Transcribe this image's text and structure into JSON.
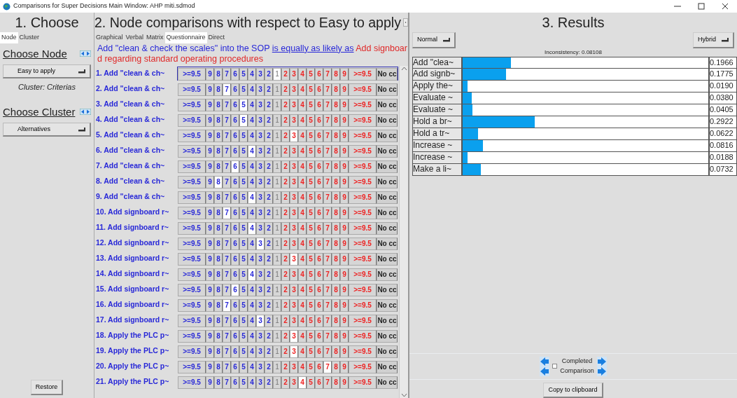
{
  "window": {
    "title": "Comparisons for Super Decisions Main Window: AHP miti.sdmod"
  },
  "choose": {
    "heading": "1. Choose",
    "tabs": [
      {
        "label": "Node",
        "selected": true
      },
      {
        "label": "Cluster",
        "selected": false
      }
    ],
    "node_label": "Choose Node",
    "node_dropdown": "Easy to apply",
    "cluster_info": "Cluster: Criterias",
    "cluster_label": "Choose Cluster",
    "cluster_dropdown": "Alternatives",
    "restore_button": "Restore"
  },
  "comparisons": {
    "heading": "2. Node comparisons with respect to Easy to apply",
    "tabs": [
      {
        "label": "Graphical",
        "selected": false
      },
      {
        "label": "Verbal",
        "selected": false
      },
      {
        "label": "Matrix",
        "selected": false
      },
      {
        "label": "Questionnaire",
        "selected": true
      },
      {
        "label": "Direct",
        "selected": false
      }
    ],
    "statement": {
      "left": "Add \"clean & check the scales\" into the SOP",
      "relation": "is equally as likely as",
      "right": "Add signboard regarding standard operating procedures"
    },
    "rows": [
      {
        "label": "1. Add \"clean & ch~",
        "current": true,
        "left": [
          {
            "text": ">=9.5",
            "selected": false
          },
          {
            "text": "9",
            "selected": false
          },
          {
            "text": "8",
            "selected": false
          },
          {
            "text": "7",
            "selected": false
          },
          {
            "text": "6",
            "selected": false
          },
          {
            "text": "5",
            "selected": false
          },
          {
            "text": "4",
            "selected": false
          },
          {
            "text": "3",
            "selected": false
          },
          {
            "text": "2",
            "selected": false
          }
        ],
        "equal": {
          "text": "1",
          "selected": true
        },
        "right": [
          {
            "text": "2",
            "selected": false
          },
          {
            "text": "3",
            "selected": false
          },
          {
            "text": "4",
            "selected": false
          },
          {
            "text": "5",
            "selected": false
          },
          {
            "text": "6",
            "selected": false
          },
          {
            "text": "7",
            "selected": false
          },
          {
            "text": "8",
            "selected": false
          },
          {
            "text": "9",
            "selected": false
          },
          {
            "text": ">=9.5",
            "selected": false
          }
        ],
        "no_comparison": "No cc"
      },
      {
        "label": "2. Add \"clean & ch~",
        "current": false,
        "left": [
          {
            "text": ">=9.5",
            "selected": false
          },
          {
            "text": "9",
            "selected": false
          },
          {
            "text": "8",
            "selected": false
          },
          {
            "text": "7",
            "selected": true
          },
          {
            "text": "6",
            "selected": false
          },
          {
            "text": "5",
            "selected": false
          },
          {
            "text": "4",
            "selected": false
          },
          {
            "text": "3",
            "selected": false
          },
          {
            "text": "2",
            "selected": false
          }
        ],
        "equal": {
          "text": "1",
          "selected": false
        },
        "right": [
          {
            "text": "2",
            "selected": false
          },
          {
            "text": "3",
            "selected": false
          },
          {
            "text": "4",
            "selected": false
          },
          {
            "text": "5",
            "selected": false
          },
          {
            "text": "6",
            "selected": false
          },
          {
            "text": "7",
            "selected": false
          },
          {
            "text": "8",
            "selected": false
          },
          {
            "text": "9",
            "selected": false
          },
          {
            "text": ">=9.5",
            "selected": false
          }
        ],
        "no_comparison": "No cc"
      },
      {
        "label": "3. Add \"clean & ch~",
        "current": false,
        "left": [
          {
            "text": ">=9.5",
            "selected": false
          },
          {
            "text": "9",
            "selected": false
          },
          {
            "text": "8",
            "selected": false
          },
          {
            "text": "7",
            "selected": false
          },
          {
            "text": "6",
            "selected": false
          },
          {
            "text": "5",
            "selected": true
          },
          {
            "text": "4",
            "selected": false
          },
          {
            "text": "3",
            "selected": false
          },
          {
            "text": "2",
            "selected": false
          }
        ],
        "equal": {
          "text": "1",
          "selected": false
        },
        "right": [
          {
            "text": "2",
            "selected": false
          },
          {
            "text": "3",
            "selected": false
          },
          {
            "text": "4",
            "selected": false
          },
          {
            "text": "5",
            "selected": false
          },
          {
            "text": "6",
            "selected": false
          },
          {
            "text": "7",
            "selected": false
          },
          {
            "text": "8",
            "selected": false
          },
          {
            "text": "9",
            "selected": false
          },
          {
            "text": ">=9.5",
            "selected": false
          }
        ],
        "no_comparison": "No cc"
      },
      {
        "label": "4. Add \"clean & ch~",
        "current": false,
        "left": [
          {
            "text": ">=9.5",
            "selected": false
          },
          {
            "text": "9",
            "selected": false
          },
          {
            "text": "8",
            "selected": false
          },
          {
            "text": "7",
            "selected": false
          },
          {
            "text": "6",
            "selected": false
          },
          {
            "text": "5",
            "selected": true
          },
          {
            "text": "4",
            "selected": false
          },
          {
            "text": "3",
            "selected": false
          },
          {
            "text": "2",
            "selected": false
          }
        ],
        "equal": {
          "text": "1",
          "selected": false
        },
        "right": [
          {
            "text": "2",
            "selected": false
          },
          {
            "text": "3",
            "selected": false
          },
          {
            "text": "4",
            "selected": false
          },
          {
            "text": "5",
            "selected": false
          },
          {
            "text": "6",
            "selected": false
          },
          {
            "text": "7",
            "selected": false
          },
          {
            "text": "8",
            "selected": false
          },
          {
            "text": "9",
            "selected": false
          },
          {
            "text": ">=9.5",
            "selected": false
          }
        ],
        "no_comparison": "No cc"
      },
      {
        "label": "5. Add \"clean & ch~",
        "current": false,
        "left": [
          {
            "text": ">=9.5",
            "selected": false
          },
          {
            "text": "9",
            "selected": false
          },
          {
            "text": "8",
            "selected": false
          },
          {
            "text": "7",
            "selected": false
          },
          {
            "text": "6",
            "selected": false
          },
          {
            "text": "5",
            "selected": false
          },
          {
            "text": "4",
            "selected": false
          },
          {
            "text": "3",
            "selected": false
          },
          {
            "text": "2",
            "selected": false
          }
        ],
        "equal": {
          "text": "1",
          "selected": false
        },
        "right": [
          {
            "text": "2",
            "selected": false
          },
          {
            "text": "3",
            "selected": true
          },
          {
            "text": "4",
            "selected": false
          },
          {
            "text": "5",
            "selected": false
          },
          {
            "text": "6",
            "selected": false
          },
          {
            "text": "7",
            "selected": false
          },
          {
            "text": "8",
            "selected": false
          },
          {
            "text": "9",
            "selected": false
          },
          {
            "text": ">=9.5",
            "selected": false
          }
        ],
        "no_comparison": "No cc"
      },
      {
        "label": "6. Add \"clean & ch~",
        "current": false,
        "left": [
          {
            "text": ">=9.5",
            "selected": false
          },
          {
            "text": "9",
            "selected": false
          },
          {
            "text": "8",
            "selected": false
          },
          {
            "text": "7",
            "selected": false
          },
          {
            "text": "6",
            "selected": false
          },
          {
            "text": "5",
            "selected": false
          },
          {
            "text": "4",
            "selected": true
          },
          {
            "text": "3",
            "selected": false
          },
          {
            "text": "2",
            "selected": false
          }
        ],
        "equal": {
          "text": "1",
          "selected": false
        },
        "right": [
          {
            "text": "2",
            "selected": false
          },
          {
            "text": "3",
            "selected": false
          },
          {
            "text": "4",
            "selected": false
          },
          {
            "text": "5",
            "selected": false
          },
          {
            "text": "6",
            "selected": false
          },
          {
            "text": "7",
            "selected": false
          },
          {
            "text": "8",
            "selected": false
          },
          {
            "text": "9",
            "selected": false
          },
          {
            "text": ">=9.5",
            "selected": false
          }
        ],
        "no_comparison": "No cc"
      },
      {
        "label": "7. Add \"clean & ch~",
        "current": false,
        "left": [
          {
            "text": ">=9.5",
            "selected": false
          },
          {
            "text": "9",
            "selected": false
          },
          {
            "text": "8",
            "selected": false
          },
          {
            "text": "7",
            "selected": false
          },
          {
            "text": "6",
            "selected": true
          },
          {
            "text": "5",
            "selected": false
          },
          {
            "text": "4",
            "selected": false
          },
          {
            "text": "3",
            "selected": false
          },
          {
            "text": "2",
            "selected": false
          }
        ],
        "equal": {
          "text": "1",
          "selected": false
        },
        "right": [
          {
            "text": "2",
            "selected": false
          },
          {
            "text": "3",
            "selected": false
          },
          {
            "text": "4",
            "selected": false
          },
          {
            "text": "5",
            "selected": false
          },
          {
            "text": "6",
            "selected": false
          },
          {
            "text": "7",
            "selected": false
          },
          {
            "text": "8",
            "selected": false
          },
          {
            "text": "9",
            "selected": false
          },
          {
            "text": ">=9.5",
            "selected": false
          }
        ],
        "no_comparison": "No cc"
      },
      {
        "label": "8. Add \"clean & ch~",
        "current": false,
        "left": [
          {
            "text": ">=9.5",
            "selected": false
          },
          {
            "text": "9",
            "selected": false
          },
          {
            "text": "8",
            "selected": true
          },
          {
            "text": "7",
            "selected": false
          },
          {
            "text": "6",
            "selected": false
          },
          {
            "text": "5",
            "selected": false
          },
          {
            "text": "4",
            "selected": false
          },
          {
            "text": "3",
            "selected": false
          },
          {
            "text": "2",
            "selected": false
          }
        ],
        "equal": {
          "text": "1",
          "selected": false
        },
        "right": [
          {
            "text": "2",
            "selected": false
          },
          {
            "text": "3",
            "selected": false
          },
          {
            "text": "4",
            "selected": false
          },
          {
            "text": "5",
            "selected": false
          },
          {
            "text": "6",
            "selected": false
          },
          {
            "text": "7",
            "selected": false
          },
          {
            "text": "8",
            "selected": false
          },
          {
            "text": "9",
            "selected": false
          },
          {
            "text": ">=9.5",
            "selected": false
          }
        ],
        "no_comparison": "No cc"
      },
      {
        "label": "9. Add \"clean & ch~",
        "current": false,
        "left": [
          {
            "text": ">=9.5",
            "selected": false
          },
          {
            "text": "9",
            "selected": false
          },
          {
            "text": "8",
            "selected": false
          },
          {
            "text": "7",
            "selected": false
          },
          {
            "text": "6",
            "selected": false
          },
          {
            "text": "5",
            "selected": false
          },
          {
            "text": "4",
            "selected": true
          },
          {
            "text": "3",
            "selected": false
          },
          {
            "text": "2",
            "selected": false
          }
        ],
        "equal": {
          "text": "1",
          "selected": false
        },
        "right": [
          {
            "text": "2",
            "selected": false
          },
          {
            "text": "3",
            "selected": false
          },
          {
            "text": "4",
            "selected": false
          },
          {
            "text": "5",
            "selected": false
          },
          {
            "text": "6",
            "selected": false
          },
          {
            "text": "7",
            "selected": false
          },
          {
            "text": "8",
            "selected": false
          },
          {
            "text": "9",
            "selected": false
          },
          {
            "text": ">=9.5",
            "selected": false
          }
        ],
        "no_comparison": "No cc"
      },
      {
        "label": "10. Add signboard r~",
        "current": false,
        "left": [
          {
            "text": ">=9.5",
            "selected": false
          },
          {
            "text": "9",
            "selected": false
          },
          {
            "text": "8",
            "selected": false
          },
          {
            "text": "7",
            "selected": true
          },
          {
            "text": "6",
            "selected": false
          },
          {
            "text": "5",
            "selected": false
          },
          {
            "text": "4",
            "selected": false
          },
          {
            "text": "3",
            "selected": false
          },
          {
            "text": "2",
            "selected": false
          }
        ],
        "equal": {
          "text": "1",
          "selected": false
        },
        "right": [
          {
            "text": "2",
            "selected": false
          },
          {
            "text": "3",
            "selected": false
          },
          {
            "text": "4",
            "selected": false
          },
          {
            "text": "5",
            "selected": false
          },
          {
            "text": "6",
            "selected": false
          },
          {
            "text": "7",
            "selected": false
          },
          {
            "text": "8",
            "selected": false
          },
          {
            "text": "9",
            "selected": false
          },
          {
            "text": ">=9.5",
            "selected": false
          }
        ],
        "no_comparison": "No cc"
      },
      {
        "label": "11. Add signboard r~",
        "current": false,
        "left": [
          {
            "text": ">=9.5",
            "selected": false
          },
          {
            "text": "9",
            "selected": false
          },
          {
            "text": "8",
            "selected": false
          },
          {
            "text": "7",
            "selected": false
          },
          {
            "text": "6",
            "selected": false
          },
          {
            "text": "5",
            "selected": false
          },
          {
            "text": "4",
            "selected": true
          },
          {
            "text": "3",
            "selected": false
          },
          {
            "text": "2",
            "selected": false
          }
        ],
        "equal": {
          "text": "1",
          "selected": false
        },
        "right": [
          {
            "text": "2",
            "selected": false
          },
          {
            "text": "3",
            "selected": false
          },
          {
            "text": "4",
            "selected": false
          },
          {
            "text": "5",
            "selected": false
          },
          {
            "text": "6",
            "selected": false
          },
          {
            "text": "7",
            "selected": false
          },
          {
            "text": "8",
            "selected": false
          },
          {
            "text": "9",
            "selected": false
          },
          {
            "text": ">=9.5",
            "selected": false
          }
        ],
        "no_comparison": "No cc"
      },
      {
        "label": "12. Add signboard r~",
        "current": false,
        "left": [
          {
            "text": ">=9.5",
            "selected": false
          },
          {
            "text": "9",
            "selected": false
          },
          {
            "text": "8",
            "selected": false
          },
          {
            "text": "7",
            "selected": false
          },
          {
            "text": "6",
            "selected": false
          },
          {
            "text": "5",
            "selected": false
          },
          {
            "text": "4",
            "selected": false
          },
          {
            "text": "3",
            "selected": true
          },
          {
            "text": "2",
            "selected": false
          }
        ],
        "equal": {
          "text": "1",
          "selected": false
        },
        "right": [
          {
            "text": "2",
            "selected": false
          },
          {
            "text": "3",
            "selected": false
          },
          {
            "text": "4",
            "selected": false
          },
          {
            "text": "5",
            "selected": false
          },
          {
            "text": "6",
            "selected": false
          },
          {
            "text": "7",
            "selected": false
          },
          {
            "text": "8",
            "selected": false
          },
          {
            "text": "9",
            "selected": false
          },
          {
            "text": ">=9.5",
            "selected": false
          }
        ],
        "no_comparison": "No cc"
      },
      {
        "label": "13. Add signboard r~",
        "current": false,
        "left": [
          {
            "text": ">=9.5",
            "selected": false
          },
          {
            "text": "9",
            "selected": false
          },
          {
            "text": "8",
            "selected": false
          },
          {
            "text": "7",
            "selected": false
          },
          {
            "text": "6",
            "selected": false
          },
          {
            "text": "5",
            "selected": false
          },
          {
            "text": "4",
            "selected": false
          },
          {
            "text": "3",
            "selected": false
          },
          {
            "text": "2",
            "selected": false
          }
        ],
        "equal": {
          "text": "1",
          "selected": false
        },
        "right": [
          {
            "text": "2",
            "selected": false
          },
          {
            "text": "3",
            "selected": true
          },
          {
            "text": "4",
            "selected": false
          },
          {
            "text": "5",
            "selected": false
          },
          {
            "text": "6",
            "selected": false
          },
          {
            "text": "7",
            "selected": false
          },
          {
            "text": "8",
            "selected": false
          },
          {
            "text": "9",
            "selected": false
          },
          {
            "text": ">=9.5",
            "selected": false
          }
        ],
        "no_comparison": "No cc"
      },
      {
        "label": "14. Add signboard r~",
        "current": false,
        "left": [
          {
            "text": ">=9.5",
            "selected": false
          },
          {
            "text": "9",
            "selected": false
          },
          {
            "text": "8",
            "selected": false
          },
          {
            "text": "7",
            "selected": false
          },
          {
            "text": "6",
            "selected": false
          },
          {
            "text": "5",
            "selected": false
          },
          {
            "text": "4",
            "selected": true
          },
          {
            "text": "3",
            "selected": false
          },
          {
            "text": "2",
            "selected": false
          }
        ],
        "equal": {
          "text": "1",
          "selected": false
        },
        "right": [
          {
            "text": "2",
            "selected": false
          },
          {
            "text": "3",
            "selected": false
          },
          {
            "text": "4",
            "selected": false
          },
          {
            "text": "5",
            "selected": false
          },
          {
            "text": "6",
            "selected": false
          },
          {
            "text": "7",
            "selected": false
          },
          {
            "text": "8",
            "selected": false
          },
          {
            "text": "9",
            "selected": false
          },
          {
            "text": ">=9.5",
            "selected": false
          }
        ],
        "no_comparison": "No cc"
      },
      {
        "label": "15. Add signboard r~",
        "current": false,
        "left": [
          {
            "text": ">=9.5",
            "selected": false
          },
          {
            "text": "9",
            "selected": false
          },
          {
            "text": "8",
            "selected": false
          },
          {
            "text": "7",
            "selected": false
          },
          {
            "text": "6",
            "selected": true
          },
          {
            "text": "5",
            "selected": false
          },
          {
            "text": "4",
            "selected": false
          },
          {
            "text": "3",
            "selected": false
          },
          {
            "text": "2",
            "selected": false
          }
        ],
        "equal": {
          "text": "1",
          "selected": false
        },
        "right": [
          {
            "text": "2",
            "selected": false
          },
          {
            "text": "3",
            "selected": false
          },
          {
            "text": "4",
            "selected": false
          },
          {
            "text": "5",
            "selected": false
          },
          {
            "text": "6",
            "selected": false
          },
          {
            "text": "7",
            "selected": false
          },
          {
            "text": "8",
            "selected": false
          },
          {
            "text": "9",
            "selected": false
          },
          {
            "text": ">=9.5",
            "selected": false
          }
        ],
        "no_comparison": "No cc"
      },
      {
        "label": "16. Add signboard r~",
        "current": false,
        "left": [
          {
            "text": ">=9.5",
            "selected": false
          },
          {
            "text": "9",
            "selected": false
          },
          {
            "text": "8",
            "selected": false
          },
          {
            "text": "7",
            "selected": true
          },
          {
            "text": "6",
            "selected": false
          },
          {
            "text": "5",
            "selected": false
          },
          {
            "text": "4",
            "selected": false
          },
          {
            "text": "3",
            "selected": false
          },
          {
            "text": "2",
            "selected": false
          }
        ],
        "equal": {
          "text": "1",
          "selected": false
        },
        "right": [
          {
            "text": "2",
            "selected": false
          },
          {
            "text": "3",
            "selected": false
          },
          {
            "text": "4",
            "selected": false
          },
          {
            "text": "5",
            "selected": false
          },
          {
            "text": "6",
            "selected": false
          },
          {
            "text": "7",
            "selected": false
          },
          {
            "text": "8",
            "selected": false
          },
          {
            "text": "9",
            "selected": false
          },
          {
            "text": ">=9.5",
            "selected": false
          }
        ],
        "no_comparison": "No cc"
      },
      {
        "label": "17. Add signboard r~",
        "current": false,
        "left": [
          {
            "text": ">=9.5",
            "selected": false
          },
          {
            "text": "9",
            "selected": false
          },
          {
            "text": "8",
            "selected": false
          },
          {
            "text": "7",
            "selected": false
          },
          {
            "text": "6",
            "selected": false
          },
          {
            "text": "5",
            "selected": false
          },
          {
            "text": "4",
            "selected": false
          },
          {
            "text": "3",
            "selected": true
          },
          {
            "text": "2",
            "selected": false
          }
        ],
        "equal": {
          "text": "1",
          "selected": false
        },
        "right": [
          {
            "text": "2",
            "selected": false
          },
          {
            "text": "3",
            "selected": false
          },
          {
            "text": "4",
            "selected": false
          },
          {
            "text": "5",
            "selected": false
          },
          {
            "text": "6",
            "selected": false
          },
          {
            "text": "7",
            "selected": false
          },
          {
            "text": "8",
            "selected": false
          },
          {
            "text": "9",
            "selected": false
          },
          {
            "text": ">=9.5",
            "selected": false
          }
        ],
        "no_comparison": "No cc"
      },
      {
        "label": "18. Apply the PLC p~",
        "current": false,
        "left": [
          {
            "text": ">=9.5",
            "selected": false
          },
          {
            "text": "9",
            "selected": false
          },
          {
            "text": "8",
            "selected": false
          },
          {
            "text": "7",
            "selected": false
          },
          {
            "text": "6",
            "selected": false
          },
          {
            "text": "5",
            "selected": false
          },
          {
            "text": "4",
            "selected": false
          },
          {
            "text": "3",
            "selected": false
          },
          {
            "text": "2",
            "selected": false
          }
        ],
        "equal": {
          "text": "1",
          "selected": false
        },
        "right": [
          {
            "text": "2",
            "selected": false
          },
          {
            "text": "3",
            "selected": true
          },
          {
            "text": "4",
            "selected": false
          },
          {
            "text": "5",
            "selected": false
          },
          {
            "text": "6",
            "selected": false
          },
          {
            "text": "7",
            "selected": false
          },
          {
            "text": "8",
            "selected": false
          },
          {
            "text": "9",
            "selected": false
          },
          {
            "text": ">=9.5",
            "selected": false
          }
        ],
        "no_comparison": "No cc"
      },
      {
        "label": "19. Apply the PLC p~",
        "current": false,
        "left": [
          {
            "text": ">=9.5",
            "selected": false
          },
          {
            "text": "9",
            "selected": false
          },
          {
            "text": "8",
            "selected": false
          },
          {
            "text": "7",
            "selected": false
          },
          {
            "text": "6",
            "selected": false
          },
          {
            "text": "5",
            "selected": false
          },
          {
            "text": "4",
            "selected": false
          },
          {
            "text": "3",
            "selected": false
          },
          {
            "text": "2",
            "selected": false
          }
        ],
        "equal": {
          "text": "1",
          "selected": false
        },
        "right": [
          {
            "text": "2",
            "selected": false
          },
          {
            "text": "3",
            "selected": true
          },
          {
            "text": "4",
            "selected": false
          },
          {
            "text": "5",
            "selected": false
          },
          {
            "text": "6",
            "selected": false
          },
          {
            "text": "7",
            "selected": false
          },
          {
            "text": "8",
            "selected": false
          },
          {
            "text": "9",
            "selected": false
          },
          {
            "text": ">=9.5",
            "selected": false
          }
        ],
        "no_comparison": "No cc"
      },
      {
        "label": "20. Apply the PLC p~",
        "current": false,
        "left": [
          {
            "text": ">=9.5",
            "selected": false
          },
          {
            "text": "9",
            "selected": false
          },
          {
            "text": "8",
            "selected": false
          },
          {
            "text": "7",
            "selected": false
          },
          {
            "text": "6",
            "selected": false
          },
          {
            "text": "5",
            "selected": false
          },
          {
            "text": "4",
            "selected": false
          },
          {
            "text": "3",
            "selected": false
          },
          {
            "text": "2",
            "selected": false
          }
        ],
        "equal": {
          "text": "1",
          "selected": false
        },
        "right": [
          {
            "text": "2",
            "selected": false
          },
          {
            "text": "3",
            "selected": false
          },
          {
            "text": "4",
            "selected": false
          },
          {
            "text": "5",
            "selected": false
          },
          {
            "text": "6",
            "selected": false
          },
          {
            "text": "7",
            "selected": true
          },
          {
            "text": "8",
            "selected": false
          },
          {
            "text": "9",
            "selected": false
          },
          {
            "text": ">=9.5",
            "selected": false
          }
        ],
        "no_comparison": "No cc"
      },
      {
        "label": "21. Apply the PLC p~",
        "current": false,
        "left": [
          {
            "text": ">=9.5",
            "selected": false
          },
          {
            "text": "9",
            "selected": false
          },
          {
            "text": "8",
            "selected": false
          },
          {
            "text": "7",
            "selected": false
          },
          {
            "text": "6",
            "selected": false
          },
          {
            "text": "5",
            "selected": false
          },
          {
            "text": "4",
            "selected": false
          },
          {
            "text": "3",
            "selected": false
          },
          {
            "text": "2",
            "selected": false
          }
        ],
        "equal": {
          "text": "1",
          "selected": false
        },
        "right": [
          {
            "text": "2",
            "selected": false
          },
          {
            "text": "3",
            "selected": false
          },
          {
            "text": "4",
            "selected": true
          },
          {
            "text": "5",
            "selected": false
          },
          {
            "text": "6",
            "selected": false
          },
          {
            "text": "7",
            "selected": false
          },
          {
            "text": "8",
            "selected": false
          },
          {
            "text": "9",
            "selected": false
          },
          {
            "text": ">=9.5",
            "selected": false
          }
        ],
        "no_comparison": "No cc"
      }
    ]
  },
  "results": {
    "heading": "3. Results",
    "mode_dropdown": "Normal",
    "method_dropdown": "Hybrid",
    "inconsistency": "Inconsistency: 0.08108",
    "items": [
      {
        "label": "Add \"clea~",
        "level": 0.1966,
        "value": "0.1966"
      },
      {
        "label": "Add signb~",
        "level": 0.1775,
        "value": "0.1775"
      },
      {
        "label": "Apply the~",
        "level": 0.019,
        "value": "0.0190"
      },
      {
        "label": "Evaluate ~",
        "level": 0.038,
        "value": "0.0380"
      },
      {
        "label": "Evaluate ~",
        "level": 0.0405,
        "value": "0.0405"
      },
      {
        "label": "Hold a br~",
        "level": 0.2922,
        "value": "0.2922"
      },
      {
        "label": "Hold a tr~",
        "level": 0.0622,
        "value": "0.0622"
      },
      {
        "label": "Increase ~",
        "level": 0.0816,
        "value": "0.0816"
      },
      {
        "label": "Increase ~",
        "level": 0.0188,
        "value": "0.0188"
      },
      {
        "label": "Make a li~",
        "level": 0.0732,
        "value": "0.0732"
      }
    ],
    "completed_label": "Completed",
    "comparison_label": "Comparison",
    "completed_checked": false,
    "copy_button": "Copy to clipboard"
  }
}
